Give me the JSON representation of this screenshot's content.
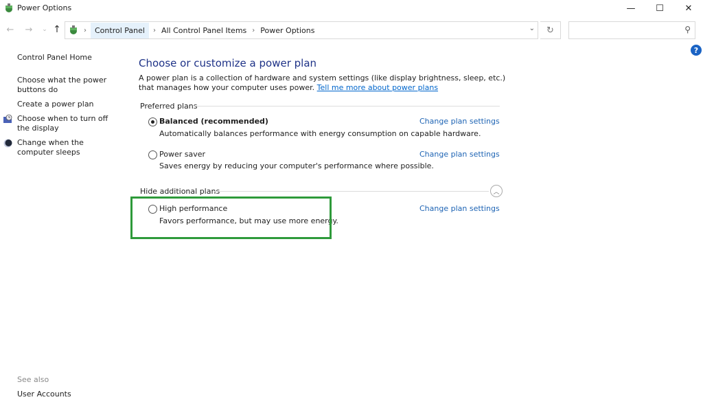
{
  "window": {
    "title": "Power Options",
    "minimize_label": "—",
    "maximize_label": "☐",
    "close_label": "✕"
  },
  "nav": {
    "back_icon": "←",
    "forward_icon": "→",
    "recent_icon": "⌄",
    "up_icon": "↑",
    "breadcrumbs": [
      "Control Panel",
      "All Control Panel Items",
      "Power Options"
    ],
    "separator": "›",
    "dropdown_icon": "⌄",
    "refresh_icon": "↻",
    "search_placeholder": "",
    "search_icon": "⚲"
  },
  "help_icon": "?",
  "sidebar": {
    "home": "Control Panel Home",
    "links": [
      {
        "label": "Choose what the power buttons do",
        "icon": null
      },
      {
        "label": "Create a power plan",
        "icon": null
      },
      {
        "label": "Choose when to turn off the display",
        "icon": "display-clock-icon"
      },
      {
        "label": "Change when the computer sleeps",
        "icon": "moon-sleep-icon"
      }
    ],
    "see_also_label": "See also",
    "see_also_links": [
      "User Accounts"
    ]
  },
  "main": {
    "title": "Choose or customize a power plan",
    "intro": "A power plan is a collection of hardware and system settings (like display brightness, sleep, etc.) that manages how your computer uses power.",
    "intro_link": "Tell me more about power plans",
    "preferred_header": "Preferred plans",
    "additional_header": "Hide additional plans",
    "collapse_icon": "︿",
    "plans": [
      {
        "name": "Balanced (recommended)",
        "description": "Automatically balances performance with energy consumption on capable hardware.",
        "selected": true,
        "link": "Change plan settings"
      },
      {
        "name": "Power saver",
        "description": "Saves energy by reducing your computer's performance where possible.",
        "selected": false,
        "link": "Change plan settings"
      },
      {
        "name": "High performance",
        "description": "Favors performance, but may use more energy.",
        "selected": false,
        "link": "Change plan settings"
      }
    ]
  },
  "colors": {
    "title_blue": "#1e3287",
    "link_blue": "#1e64b4",
    "highlight_green": "#2e9a3a",
    "help_blue": "#1a63c4"
  }
}
